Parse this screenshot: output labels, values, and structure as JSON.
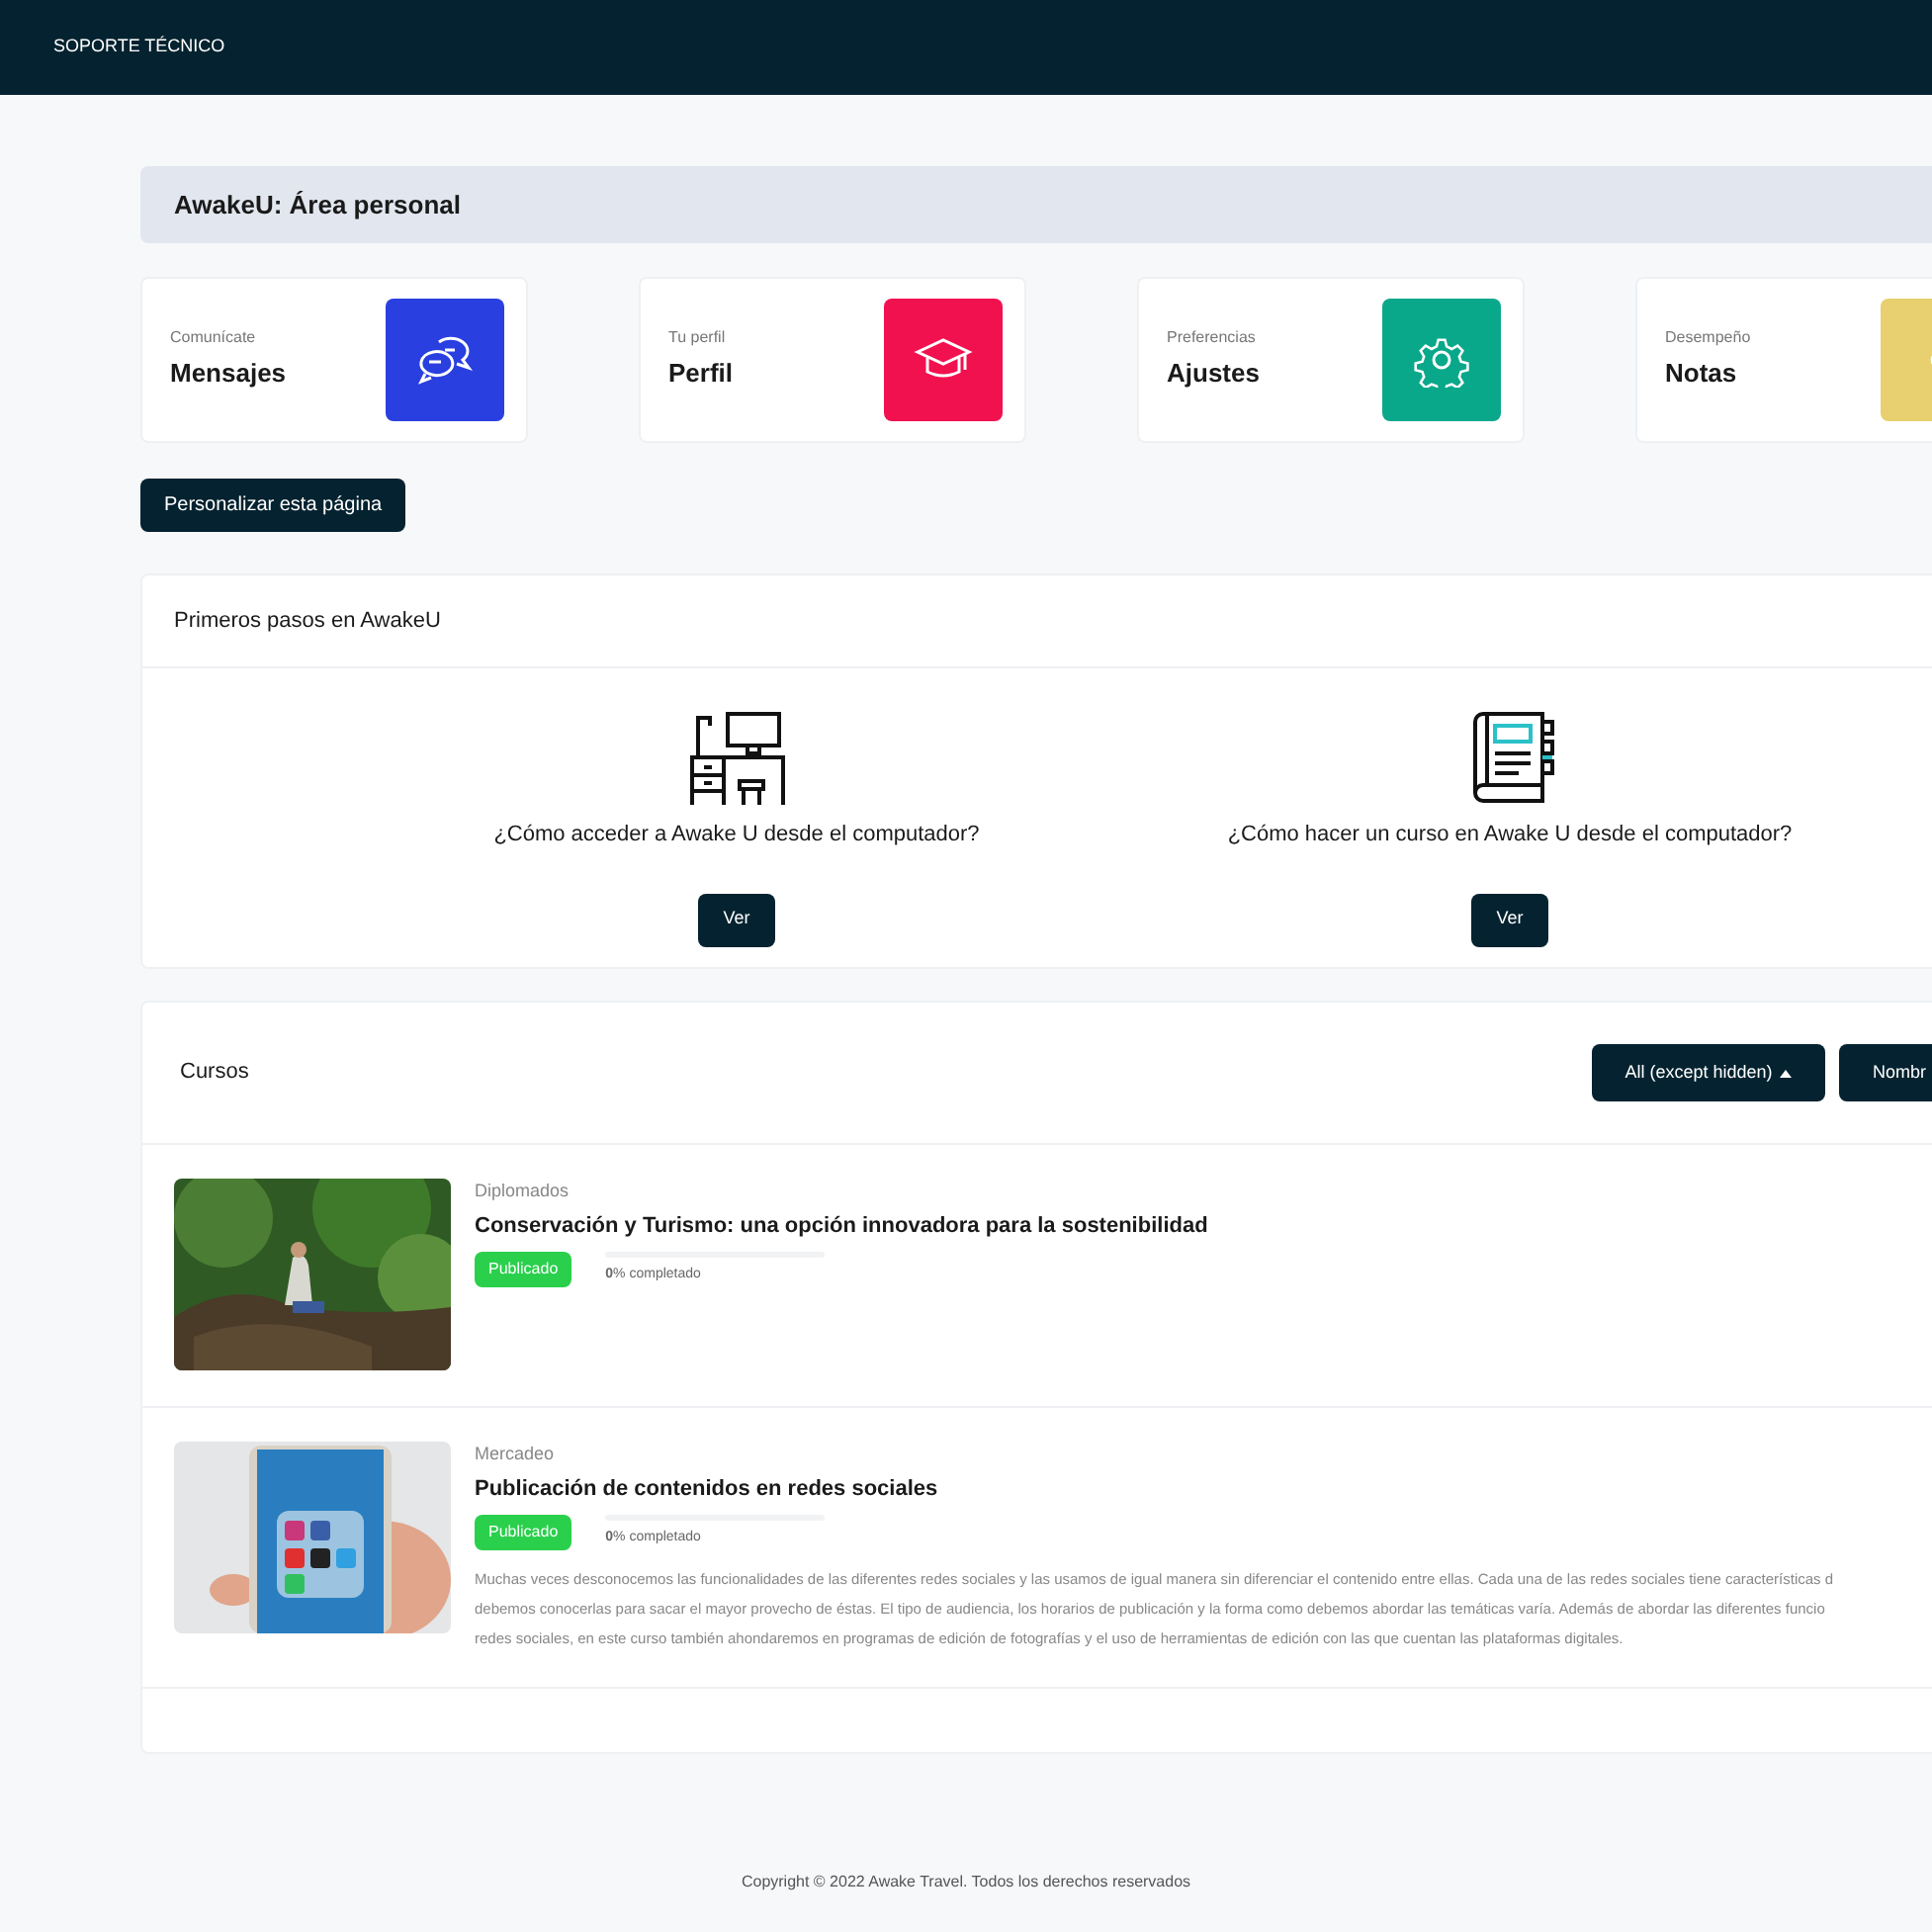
{
  "top_bar": {
    "nav_items": [
      {
        "label": "SOPORTE TÉCNICO"
      }
    ]
  },
  "page_title": "AwakeU: Área personal",
  "cards": [
    {
      "caption": "Comunícate",
      "title": "Mensajes",
      "color": "#2a3fe0"
    },
    {
      "caption": "Tu perfil",
      "title": "Perfil",
      "color": "#f2114f"
    },
    {
      "caption": "Preferencias",
      "title": "Ajustes",
      "color": "#0aa88a"
    },
    {
      "caption": "Desempeño",
      "title": "Notas",
      "color": "#e8cf6f"
    }
  ],
  "customize_button": "Personalizar esta página",
  "getting_started": {
    "title": "Primeros pasos en AwakeU",
    "items": [
      {
        "question": "¿Cómo acceder a Awake U desde el computador?",
        "button": "Ver"
      },
      {
        "question": "¿Cómo hacer un curso en Awake U desde el computador?",
        "button": "Ver"
      }
    ]
  },
  "courses": {
    "title": "Cursos",
    "filter_button": "All (except hidden)",
    "sort_button": "Nombr",
    "items": [
      {
        "kind": "picture",
        "category": "Diplomados",
        "title": "Conservación y Turismo: una opción innovadora para la sostenibilidad",
        "status": "Publicado",
        "level": 0,
        "progress_text": "**0**% completado"
      },
      {
        "kind": "picture",
        "category": "Mercadeo",
        "title": "Publicación de contenidos en redes sociales",
        "status": "Publicado",
        "level": 0,
        "progress_text": "**0**% completado",
        "description_lines": [
          "Muchas veces desconocemos las funcionalidades de las diferentes redes sociales y las usamos de igual manera sin diferenciar el contenido entre ellas. Cada una de las redes sociales tiene características d",
          "debemos conocerlas para sacar el mayor provecho de éstas. El tipo de audiencia, los horarios de publicación y la forma como debemos abordar las temáticas varía. Además de abordar las diferentes funcio",
          "redes sociales, en este curso también ahondaremos en programas de edición de fotografías y el uso de herramientas de edición con las que cuentan las plataformas digitales."
        ]
      }
    ]
  },
  "footer": "Copyright © 2022 Awake Travel. Todos los derechos reservados"
}
